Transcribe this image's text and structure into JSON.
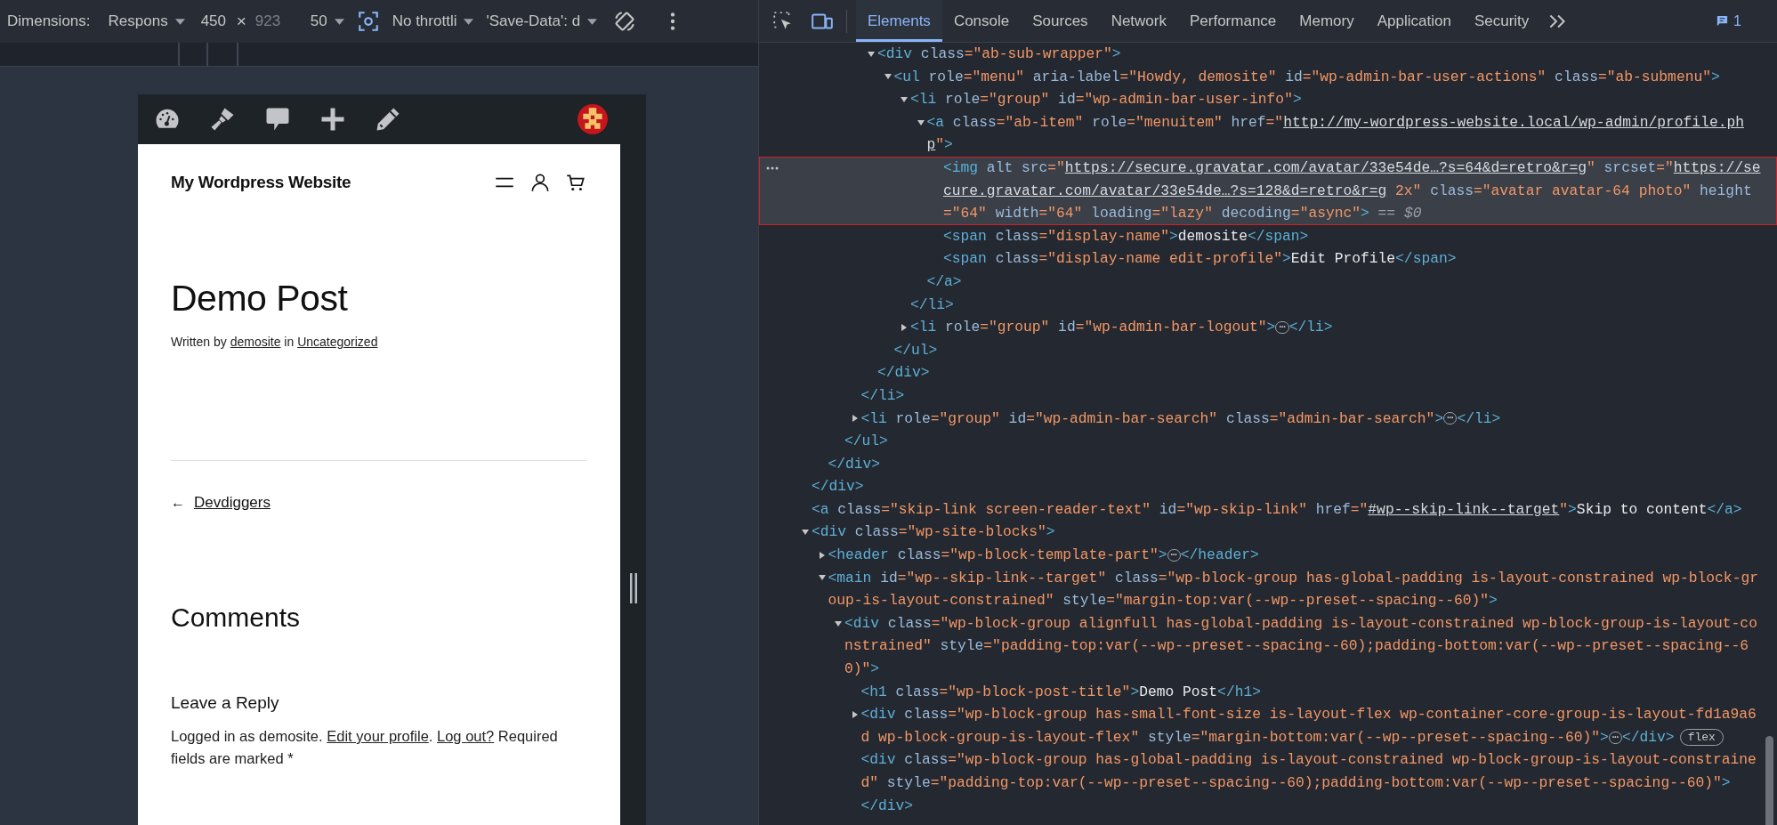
{
  "device_toolbar": {
    "dimensions_label": "Dimensions:",
    "device_mode": "Respons",
    "width_value": "450",
    "times_sign": "×",
    "height_value": "923",
    "zoom": "50",
    "throttling": "No throttli",
    "save_data": "'Save-Data': d"
  },
  "devtools_toolbar": {
    "device_toggle": {
      "on": true
    },
    "tabs": [
      {
        "label": "Elements",
        "selected": true
      },
      {
        "label": "Console",
        "selected": false
      },
      {
        "label": "Sources",
        "selected": false
      },
      {
        "label": "Network",
        "selected": false
      },
      {
        "label": "Performance",
        "selected": false
      },
      {
        "label": "Memory",
        "selected": false
      },
      {
        "label": "Application",
        "selected": false
      },
      {
        "label": "Security",
        "selected": false
      }
    ],
    "issues_count": "1"
  },
  "page": {
    "site_title": "My Wordpress Website",
    "post_title": "Demo Post",
    "byline": [
      {
        "text": "Written by ",
        "link": false
      },
      {
        "text": "demosite",
        "link": true
      },
      {
        "text": " in ",
        "link": false
      },
      {
        "text": "Uncategorized",
        "link": true
      }
    ],
    "back_arrow": "←",
    "back_link": "Devdiggers",
    "comments_heading": "Comments",
    "reply_heading": "Leave a Reply",
    "logged_in": [
      {
        "text": "Logged in as demosite. ",
        "link": false
      },
      {
        "text": "Edit your profile",
        "link": true
      },
      {
        "text": ". ",
        "link": false
      },
      {
        "text": "Log out?",
        "link": true
      },
      {
        "text": " Required fields are marked *",
        "link": false
      }
    ]
  },
  "dom_tree": [
    {
      "close": "</div>",
      "children": [
        {
          "close": "</div>",
          "children": [
            {
              "close": "</ul>",
              "children": [
                {
                  "close": "</li>",
                  "children": [
                    {
                      "selected": false,
                      "expanded": true,
                      "close": "</div>",
                      "open": [
                        {
                          "kind": "tag",
                          "text": "<div"
                        },
                        {
                          "kind": "attr",
                          "text": " class"
                        },
                        {
                          "kind": "value",
                          "text": "=\"ab-sub-wrapper\""
                        },
                        {
                          "kind": "tag",
                          "text": ">"
                        }
                      ],
                      "children": [
                        {
                          "selected": false,
                          "expanded": true,
                          "close": "</ul>",
                          "open": [
                            {
                              "kind": "tag",
                              "text": "<ul"
                            },
                            {
                              "kind": "attr",
                              "text": " role"
                            },
                            {
                              "kind": "value",
                              "text": "=\"menu\""
                            },
                            {
                              "kind": "attr",
                              "text": " aria-label"
                            },
                            {
                              "kind": "value",
                              "text": "=\"Howdy, demosite\""
                            },
                            {
                              "kind": "attr",
                              "text": " id"
                            },
                            {
                              "kind": "value",
                              "text": "=\"wp-admin-bar-user-actions\""
                            },
                            {
                              "kind": "attr",
                              "text": " class"
                            },
                            {
                              "kind": "value",
                              "text": "=\"ab-submenu\""
                            },
                            {
                              "kind": "tag",
                              "text": ">"
                            }
                          ],
                          "children": [
                            {
                              "selected": false,
                              "expanded": true,
                              "close": "</li>",
                              "open": [
                                {
                                  "kind": "tag",
                                  "text": "<li"
                                },
                                {
                                  "kind": "attr",
                                  "text": " role"
                                },
                                {
                                  "kind": "value",
                                  "text": "=\"group\""
                                },
                                {
                                  "kind": "attr",
                                  "text": " id"
                                },
                                {
                                  "kind": "value",
                                  "text": "=\"wp-admin-bar-user-info\""
                                },
                                {
                                  "kind": "tag",
                                  "text": ">"
                                }
                              ],
                              "children": [
                                {
                                  "selected": false,
                                  "expanded": true,
                                  "close": "</a>",
                                  "open": [
                                    {
                                      "kind": "tag",
                                      "text": "<a"
                                    },
                                    {
                                      "kind": "attr",
                                      "text": " class"
                                    },
                                    {
                                      "kind": "value",
                                      "text": "=\"ab-item\""
                                    },
                                    {
                                      "kind": "attr",
                                      "text": " role"
                                    },
                                    {
                                      "kind": "value",
                                      "text": "=\"menuitem\""
                                    },
                                    {
                                      "kind": "attr",
                                      "text": " href"
                                    },
                                    {
                                      "kind": "value",
                                      "text": "=\""
                                    },
                                    {
                                      "kind": "link",
                                      "text": "http://my-wordpress-website.local/wp-admin/profile.php"
                                    },
                                    {
                                      "kind": "value",
                                      "text": "\""
                                    },
                                    {
                                      "kind": "tag",
                                      "text": ">"
                                    }
                                  ],
                                  "children": [
                                    {
                                      "selected": true,
                                      "open": [
                                        {
                                          "kind": "tag",
                                          "text": "<img"
                                        },
                                        {
                                          "kind": "attr",
                                          "text": " alt src"
                                        },
                                        {
                                          "kind": "value",
                                          "text": "=\""
                                        },
                                        {
                                          "kind": "link",
                                          "text": "https://secure.gravatar.com/avatar/33e54de…?s=64&d=retro&r=g"
                                        },
                                        {
                                          "kind": "value",
                                          "text": "\""
                                        },
                                        {
                                          "kind": "attr",
                                          "text": " srcset"
                                        },
                                        {
                                          "kind": "value",
                                          "text": "=\""
                                        },
                                        {
                                          "kind": "link",
                                          "text": "https://secure.gravatar.com/avatar/33e54de…?s=128&d=retro&r=g"
                                        },
                                        {
                                          "kind": "value",
                                          "text": " 2x\""
                                        },
                                        {
                                          "kind": "attr",
                                          "text": " class"
                                        },
                                        {
                                          "kind": "value",
                                          "text": "=\"avatar avatar-64 photo\""
                                        },
                                        {
                                          "kind": "attr",
                                          "text": " height"
                                        },
                                        {
                                          "kind": "value",
                                          "text": "=\"64\""
                                        },
                                        {
                                          "kind": "attr",
                                          "text": " width"
                                        },
                                        {
                                          "kind": "value",
                                          "text": "=\"64\""
                                        },
                                        {
                                          "kind": "attr",
                                          "text": " loading"
                                        },
                                        {
                                          "kind": "value",
                                          "text": "=\"lazy\""
                                        },
                                        {
                                          "kind": "attr",
                                          "text": " decoding"
                                        },
                                        {
                                          "kind": "value",
                                          "text": "=\"async\""
                                        },
                                        {
                                          "kind": "tag",
                                          "text": ">"
                                        },
                                        {
                                          "kind": "muted",
                                          "text": " == $0"
                                        }
                                      ]
                                    },
                                    {
                                      "selected": false,
                                      "open": [
                                        {
                                          "kind": "tag",
                                          "text": "<span"
                                        },
                                        {
                                          "kind": "attr",
                                          "text": " class"
                                        },
                                        {
                                          "kind": "value",
                                          "text": "=\"display-name\""
                                        },
                                        {
                                          "kind": "tag",
                                          "text": ">"
                                        },
                                        {
                                          "kind": "text",
                                          "text": "demosite"
                                        },
                                        {
                                          "kind": "tag",
                                          "text": "</span>"
                                        }
                                      ]
                                    },
                                    {
                                      "selected": false,
                                      "open": [
                                        {
                                          "kind": "tag",
                                          "text": "<span"
                                        },
                                        {
                                          "kind": "attr",
                                          "text": " class"
                                        },
                                        {
                                          "kind": "value",
                                          "text": "=\"display-name edit-profile\""
                                        },
                                        {
                                          "kind": "tag",
                                          "text": ">"
                                        },
                                        {
                                          "kind": "text",
                                          "text": "Edit Profile"
                                        },
                                        {
                                          "kind": "tag",
                                          "text": "</span>"
                                        }
                                      ]
                                    }
                                  ]
                                }
                              ]
                            },
                            {
                              "selected": false,
                              "expanded": false,
                              "open": [
                                {
                                  "kind": "tag",
                                  "text": "<li"
                                },
                                {
                                  "kind": "attr",
                                  "text": " role"
                                },
                                {
                                  "kind": "value",
                                  "text": "=\"group\""
                                },
                                {
                                  "kind": "attr",
                                  "text": " id"
                                },
                                {
                                  "kind": "value",
                                  "text": "=\"wp-admin-bar-logout\""
                                },
                                {
                                  "kind": "tag",
                                  "text": ">"
                                },
                                {
                                  "kind": "ellipsis",
                                  "text": "⋯"
                                },
                                {
                                  "kind": "tag",
                                  "text": "</li>"
                                }
                              ]
                            }
                          ]
                        }
                      ]
                    }
                  ]
                },
                {
                  "selected": false,
                  "expanded": false,
                  "open": [
                    {
                      "kind": "tag",
                      "text": "<li"
                    },
                    {
                      "kind": "attr",
                      "text": " role"
                    },
                    {
                      "kind": "value",
                      "text": "=\"group\""
                    },
                    {
                      "kind": "attr",
                      "text": " id"
                    },
                    {
                      "kind": "value",
                      "text": "=\"wp-admin-bar-search\""
                    },
                    {
                      "kind": "attr",
                      "text": " class"
                    },
                    {
                      "kind": "value",
                      "text": "=\"admin-bar-search\""
                    },
                    {
                      "kind": "tag",
                      "text": ">"
                    },
                    {
                      "kind": "ellipsis",
                      "text": "⋯"
                    },
                    {
                      "kind": "tag",
                      "text": "</li>"
                    }
                  ]
                }
              ]
            }
          ]
        }
      ]
    },
    {
      "selected": false,
      "open": [
        {
          "kind": "tag",
          "text": "<a"
        },
        {
          "kind": "attr",
          "text": " class"
        },
        {
          "kind": "value",
          "text": "=\"skip-link screen-reader-text\""
        },
        {
          "kind": "attr",
          "text": " id"
        },
        {
          "kind": "value",
          "text": "=\"wp-skip-link\""
        },
        {
          "kind": "attr",
          "text": " href"
        },
        {
          "kind": "value",
          "text": "=\""
        },
        {
          "kind": "link",
          "text": "#wp--skip-link--target"
        },
        {
          "kind": "value",
          "text": "\""
        },
        {
          "kind": "tag",
          "text": ">"
        },
        {
          "kind": "text",
          "text": "Skip to content"
        },
        {
          "kind": "tag",
          "text": "</a>"
        }
      ]
    },
    {
      "selected": false,
      "expanded": true,
      "open": [
        {
          "kind": "tag",
          "text": "<div"
        },
        {
          "kind": "attr",
          "text": " class"
        },
        {
          "kind": "value",
          "text": "=\"wp-site-blocks\""
        },
        {
          "kind": "tag",
          "text": ">"
        }
      ],
      "children": [
        {
          "selected": false,
          "expanded": false,
          "open": [
            {
              "kind": "tag",
              "text": "<header"
            },
            {
              "kind": "attr",
              "text": " class"
            },
            {
              "kind": "value",
              "text": "=\"wp-block-template-part\""
            },
            {
              "kind": "tag",
              "text": ">"
            },
            {
              "kind": "ellipsis",
              "text": "⋯"
            },
            {
              "kind": "tag",
              "text": "</header>"
            }
          ]
        },
        {
          "selected": false,
          "expanded": true,
          "open": [
            {
              "kind": "tag",
              "text": "<main"
            },
            {
              "kind": "attr",
              "text": " id"
            },
            {
              "kind": "value",
              "text": "=\"wp--skip-link--target\""
            },
            {
              "kind": "attr",
              "text": " class"
            },
            {
              "kind": "value",
              "text": "=\"wp-block-group has-global-padding is-layout-constrained wp-block-group-is-layout-constrained\""
            },
            {
              "kind": "attr",
              "text": " style"
            },
            {
              "kind": "value",
              "text": "=\"margin-top:var(--wp--preset--spacing--60)\""
            },
            {
              "kind": "tag",
              "text": ">"
            }
          ],
          "children": [
            {
              "selected": false,
              "expanded": true,
              "open": [
                {
                  "kind": "tag",
                  "text": "<div"
                },
                {
                  "kind": "attr",
                  "text": " class"
                },
                {
                  "kind": "value",
                  "text": "=\"wp-block-group alignfull has-global-padding is-layout-constrained wp-block-group-is-layout-constrained\""
                },
                {
                  "kind": "attr",
                  "text": " style"
                },
                {
                  "kind": "value",
                  "text": "=\"padding-top:var(--wp--preset--spacing--60);padding-bottom:var(--wp--preset--spacing--60)\""
                },
                {
                  "kind": "tag",
                  "text": ">"
                }
              ],
              "children": [
                {
                  "selected": false,
                  "open": [
                    {
                      "kind": "tag",
                      "text": "<h1"
                    },
                    {
                      "kind": "attr",
                      "text": " class"
                    },
                    {
                      "kind": "value",
                      "text": "=\"wp-block-post-title\""
                    },
                    {
                      "kind": "tag",
                      "text": ">"
                    },
                    {
                      "kind": "text",
                      "text": "Demo Post"
                    },
                    {
                      "kind": "tag",
                      "text": "</h1>"
                    }
                  ]
                },
                {
                  "selected": false,
                  "expanded": false,
                  "open": [
                    {
                      "kind": "tag",
                      "text": "<div"
                    },
                    {
                      "kind": "attr",
                      "text": " class"
                    },
                    {
                      "kind": "value",
                      "text": "=\"wp-block-group has-small-font-size is-layout-flex wp-container-core-group-is-layout-fd1a9a6d wp-block-group-is-layout-flex\""
                    },
                    {
                      "kind": "attr",
                      "text": " style"
                    },
                    {
                      "kind": "value",
                      "text": "=\"margin-bottom:var(--wp--preset--spacing--60)\""
                    },
                    {
                      "kind": "tag",
                      "text": ">"
                    },
                    {
                      "kind": "ellipsis",
                      "text": "⋯"
                    },
                    {
                      "kind": "tag",
                      "text": "</div>"
                    },
                    {
                      "kind": "badge",
                      "text": "flex"
                    }
                  ]
                },
                {
                  "selected": false,
                  "close": "</div>",
                  "open": [
                    {
                      "kind": "tag",
                      "text": "<div"
                    },
                    {
                      "kind": "attr",
                      "text": " class"
                    },
                    {
                      "kind": "value",
                      "text": "=\"wp-block-group has-global-padding is-layout-constrained wp-block-group-is-layout-constrained\""
                    },
                    {
                      "kind": "attr",
                      "text": " style"
                    },
                    {
                      "kind": "value",
                      "text": "=\"padding-top:var(--wp--preset--spacing--60);padding-bottom:var(--wp--preset--spacing--60)\""
                    },
                    {
                      "kind": "tag",
                      "text": ">"
                    }
                  ]
                }
              ]
            }
          ]
        }
      ]
    }
  ]
}
